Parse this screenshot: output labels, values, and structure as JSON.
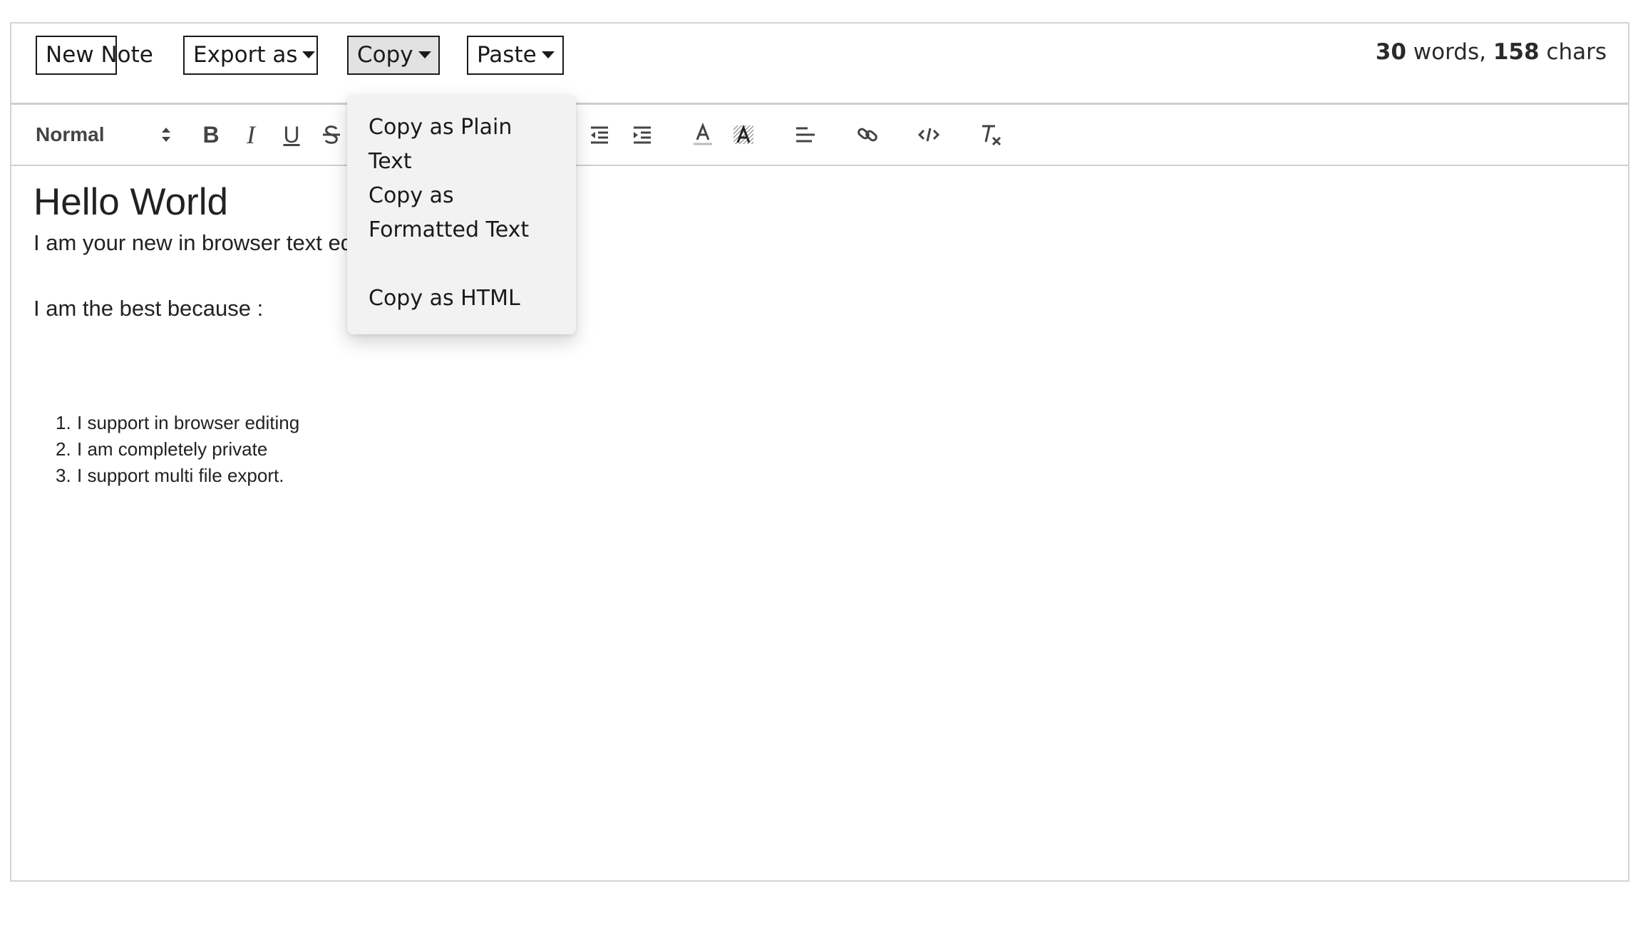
{
  "topbar": {
    "new_note": "New Note",
    "export_as": "Export as",
    "copy": "Copy",
    "paste": "Paste",
    "word_count": "30",
    "words_suffix": " words, ",
    "char_count": "158",
    "chars_suffix": " chars"
  },
  "toolbar": {
    "header_value": "Normal",
    "bold": "B",
    "italic": "I",
    "underline": "U"
  },
  "editor": {
    "heading": "Hello World",
    "para1": "I am your new in browser text editor.",
    "para2": "I am the best because :",
    "list": [
      {
        "num": "1.",
        "text": "I support in browser editing"
      },
      {
        "num": "2.",
        "text": "I am completely private"
      },
      {
        "num": "3.",
        "text": "I support multi file export."
      }
    ]
  },
  "copy_menu": {
    "plain": "Copy as Plain Text",
    "formatted": "Copy as Formatted Text",
    "html": "Copy as HTML"
  },
  "colors": {
    "active_button": "#e2e2e2",
    "dropdown_bg": "#f2f2f2",
    "border": "#cfcfcf",
    "icon": "#444444"
  }
}
